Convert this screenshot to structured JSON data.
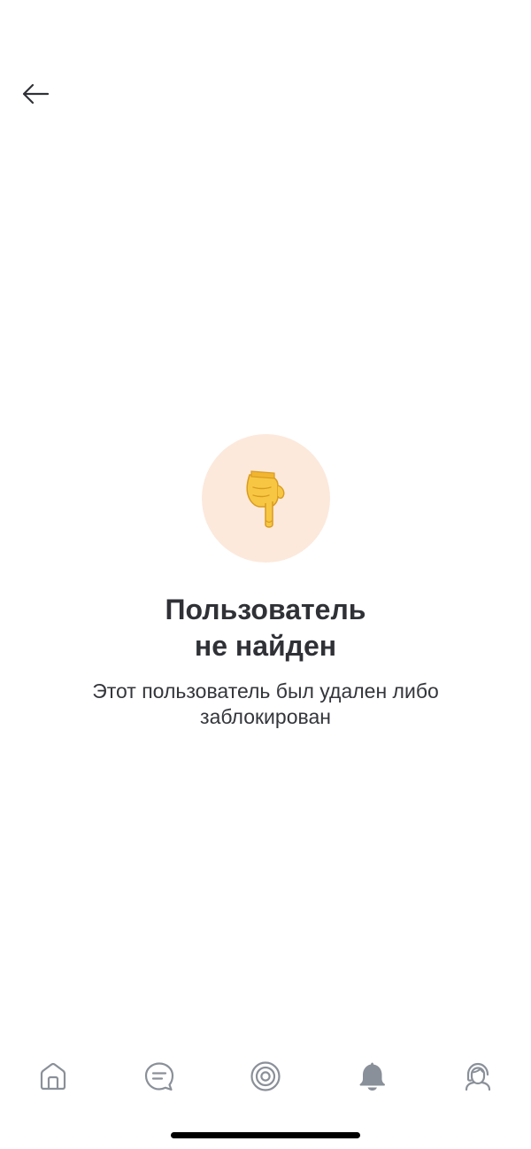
{
  "header": {
    "back_icon": "arrow-left-icon"
  },
  "empty_state": {
    "emoji_icon": "pointing-down-hand-emoji",
    "title_line1": "Пользователь",
    "title_line2": "не найден",
    "subtitle": "Этот пользователь был удален либо заблокирован"
  },
  "tabbar": {
    "tabs": [
      {
        "icon": "home-icon",
        "active": false
      },
      {
        "icon": "chat-icon",
        "active": false
      },
      {
        "icon": "target-icon",
        "active": false
      },
      {
        "icon": "bell-icon",
        "active": true
      },
      {
        "icon": "support-agent-icon",
        "active": false
      }
    ]
  },
  "colors": {
    "accent_circle": "#fce9dc",
    "text_dark": "#2f3136",
    "tab_icon": "#8a9099",
    "tab_icon_active": "#8a9099"
  }
}
